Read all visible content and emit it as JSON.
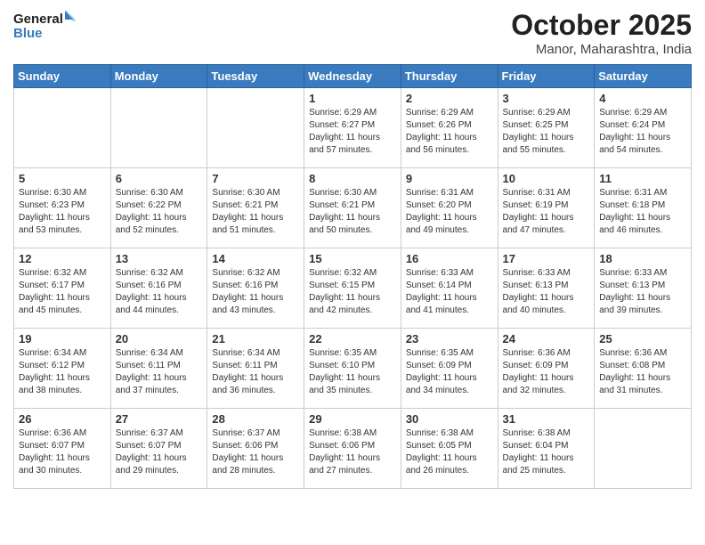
{
  "logo": {
    "line1": "General",
    "line2": "Blue"
  },
  "title": "October 2025",
  "subtitle": "Manor, Maharashtra, India",
  "weekdays": [
    "Sunday",
    "Monday",
    "Tuesday",
    "Wednesday",
    "Thursday",
    "Friday",
    "Saturday"
  ],
  "weeks": [
    [
      {
        "day": "",
        "info": ""
      },
      {
        "day": "",
        "info": ""
      },
      {
        "day": "",
        "info": ""
      },
      {
        "day": "1",
        "info": "Sunrise: 6:29 AM\nSunset: 6:27 PM\nDaylight: 11 hours and 57 minutes."
      },
      {
        "day": "2",
        "info": "Sunrise: 6:29 AM\nSunset: 6:26 PM\nDaylight: 11 hours and 56 minutes."
      },
      {
        "day": "3",
        "info": "Sunrise: 6:29 AM\nSunset: 6:25 PM\nDaylight: 11 hours and 55 minutes."
      },
      {
        "day": "4",
        "info": "Sunrise: 6:29 AM\nSunset: 6:24 PM\nDaylight: 11 hours and 54 minutes."
      }
    ],
    [
      {
        "day": "5",
        "info": "Sunrise: 6:30 AM\nSunset: 6:23 PM\nDaylight: 11 hours and 53 minutes."
      },
      {
        "day": "6",
        "info": "Sunrise: 6:30 AM\nSunset: 6:22 PM\nDaylight: 11 hours and 52 minutes."
      },
      {
        "day": "7",
        "info": "Sunrise: 6:30 AM\nSunset: 6:21 PM\nDaylight: 11 hours and 51 minutes."
      },
      {
        "day": "8",
        "info": "Sunrise: 6:30 AM\nSunset: 6:21 PM\nDaylight: 11 hours and 50 minutes."
      },
      {
        "day": "9",
        "info": "Sunrise: 6:31 AM\nSunset: 6:20 PM\nDaylight: 11 hours and 49 minutes."
      },
      {
        "day": "10",
        "info": "Sunrise: 6:31 AM\nSunset: 6:19 PM\nDaylight: 11 hours and 47 minutes."
      },
      {
        "day": "11",
        "info": "Sunrise: 6:31 AM\nSunset: 6:18 PM\nDaylight: 11 hours and 46 minutes."
      }
    ],
    [
      {
        "day": "12",
        "info": "Sunrise: 6:32 AM\nSunset: 6:17 PM\nDaylight: 11 hours and 45 minutes."
      },
      {
        "day": "13",
        "info": "Sunrise: 6:32 AM\nSunset: 6:16 PM\nDaylight: 11 hours and 44 minutes."
      },
      {
        "day": "14",
        "info": "Sunrise: 6:32 AM\nSunset: 6:16 PM\nDaylight: 11 hours and 43 minutes."
      },
      {
        "day": "15",
        "info": "Sunrise: 6:32 AM\nSunset: 6:15 PM\nDaylight: 11 hours and 42 minutes."
      },
      {
        "day": "16",
        "info": "Sunrise: 6:33 AM\nSunset: 6:14 PM\nDaylight: 11 hours and 41 minutes."
      },
      {
        "day": "17",
        "info": "Sunrise: 6:33 AM\nSunset: 6:13 PM\nDaylight: 11 hours and 40 minutes."
      },
      {
        "day": "18",
        "info": "Sunrise: 6:33 AM\nSunset: 6:13 PM\nDaylight: 11 hours and 39 minutes."
      }
    ],
    [
      {
        "day": "19",
        "info": "Sunrise: 6:34 AM\nSunset: 6:12 PM\nDaylight: 11 hours and 38 minutes."
      },
      {
        "day": "20",
        "info": "Sunrise: 6:34 AM\nSunset: 6:11 PM\nDaylight: 11 hours and 37 minutes."
      },
      {
        "day": "21",
        "info": "Sunrise: 6:34 AM\nSunset: 6:11 PM\nDaylight: 11 hours and 36 minutes."
      },
      {
        "day": "22",
        "info": "Sunrise: 6:35 AM\nSunset: 6:10 PM\nDaylight: 11 hours and 35 minutes."
      },
      {
        "day": "23",
        "info": "Sunrise: 6:35 AM\nSunset: 6:09 PM\nDaylight: 11 hours and 34 minutes."
      },
      {
        "day": "24",
        "info": "Sunrise: 6:36 AM\nSunset: 6:09 PM\nDaylight: 11 hours and 32 minutes."
      },
      {
        "day": "25",
        "info": "Sunrise: 6:36 AM\nSunset: 6:08 PM\nDaylight: 11 hours and 31 minutes."
      }
    ],
    [
      {
        "day": "26",
        "info": "Sunrise: 6:36 AM\nSunset: 6:07 PM\nDaylight: 11 hours and 30 minutes."
      },
      {
        "day": "27",
        "info": "Sunrise: 6:37 AM\nSunset: 6:07 PM\nDaylight: 11 hours and 29 minutes."
      },
      {
        "day": "28",
        "info": "Sunrise: 6:37 AM\nSunset: 6:06 PM\nDaylight: 11 hours and 28 minutes."
      },
      {
        "day": "29",
        "info": "Sunrise: 6:38 AM\nSunset: 6:06 PM\nDaylight: 11 hours and 27 minutes."
      },
      {
        "day": "30",
        "info": "Sunrise: 6:38 AM\nSunset: 6:05 PM\nDaylight: 11 hours and 26 minutes."
      },
      {
        "day": "31",
        "info": "Sunrise: 6:38 AM\nSunset: 6:04 PM\nDaylight: 11 hours and 25 minutes."
      },
      {
        "day": "",
        "info": ""
      }
    ]
  ]
}
